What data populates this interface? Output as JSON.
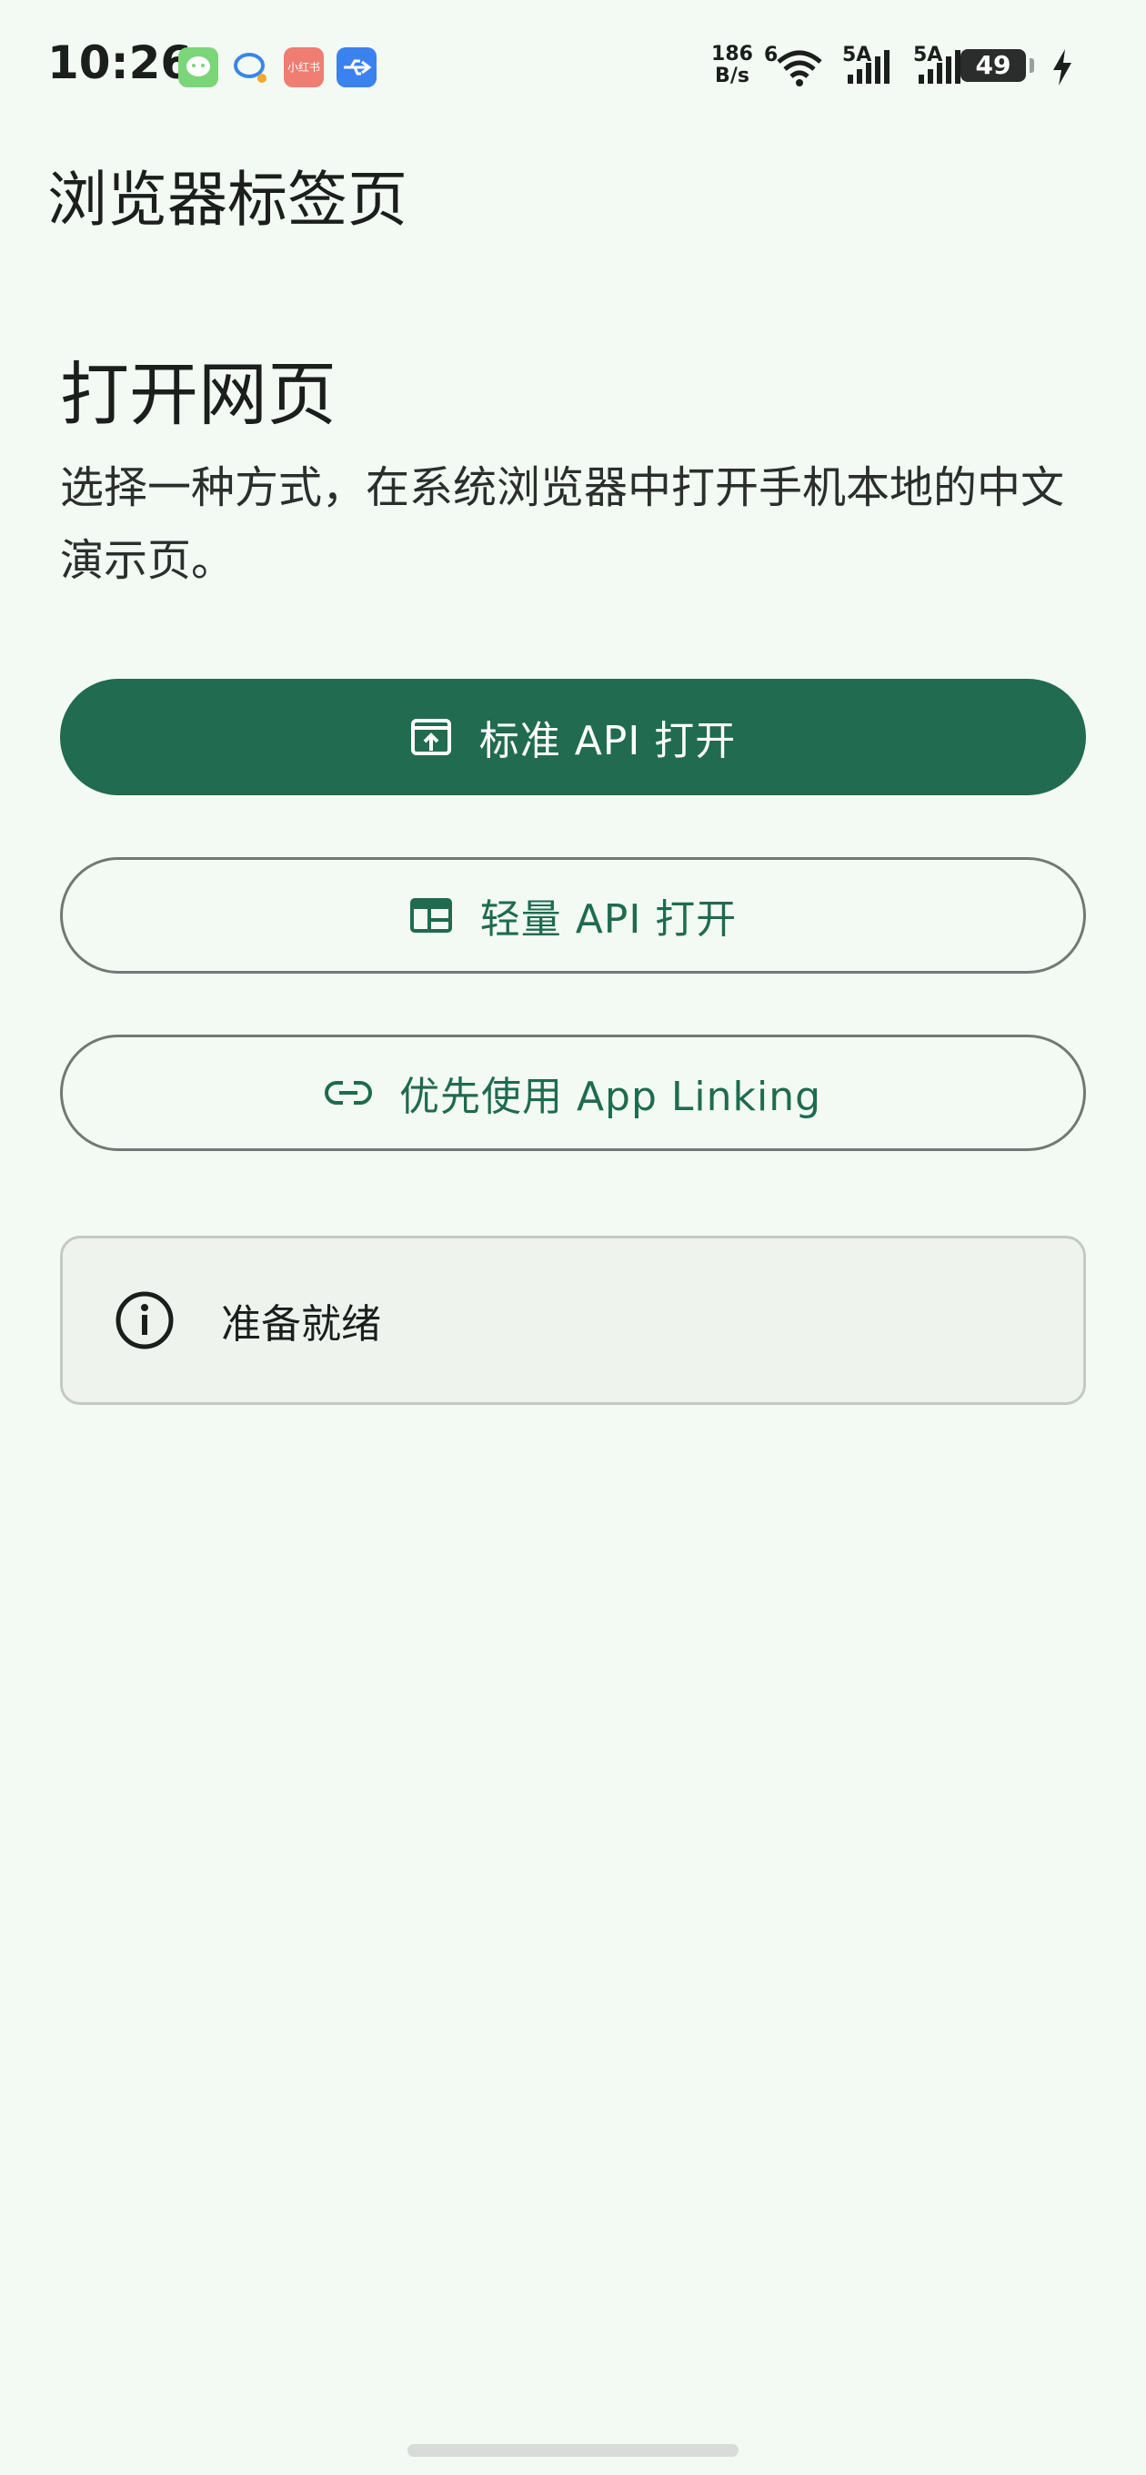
{
  "status_bar": {
    "time": "10:26",
    "net_speed_value": "186",
    "net_speed_unit": "B/s",
    "wifi_label": "6",
    "sim1_label": "5A",
    "sim2_label": "5A",
    "battery": "49",
    "notifications": [
      "wechat-icon",
      "chat-icon",
      "xiaohongshu-icon",
      "usb-icon"
    ],
    "xiaohongshu_label": "小红书"
  },
  "app_bar": {
    "title": "浏览器标签页"
  },
  "main": {
    "title": "打开网页",
    "description": "选择一种方式，在系统浏览器中打开手机本地的中文演示页。",
    "buttons": {
      "standard": "标准 API 打开",
      "light": "轻量 API 打开",
      "app_linking": "优先使用 App Linking"
    },
    "status": "准备就绪"
  },
  "colors": {
    "primary": "#216b50",
    "background": "#f3faf4",
    "outline": "#727873",
    "card": "#eef3ee"
  }
}
